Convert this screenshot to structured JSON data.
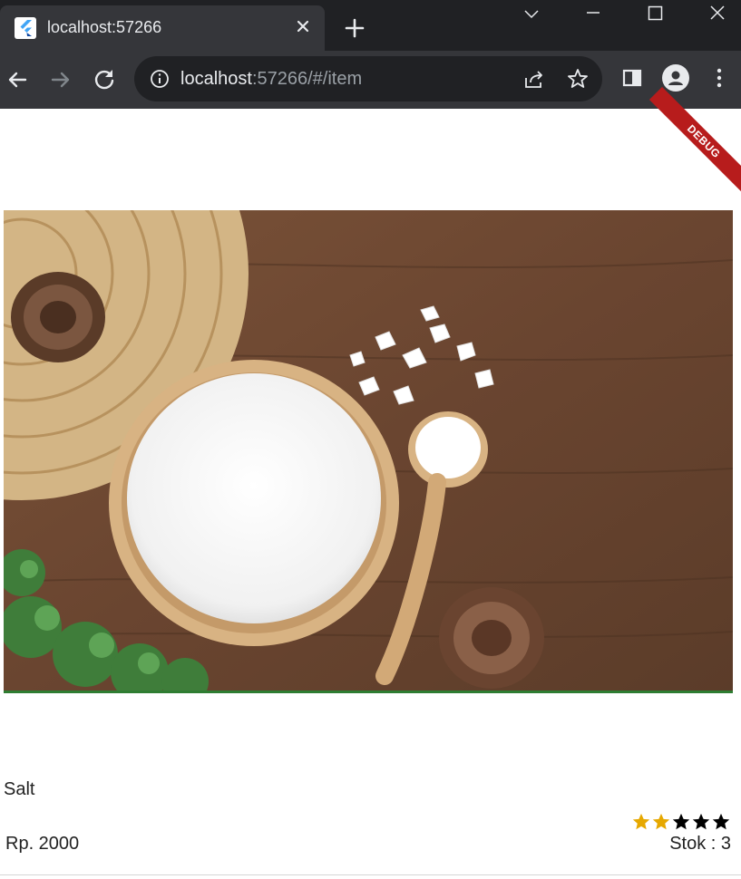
{
  "browser": {
    "tab": {
      "title": "localhost:57266",
      "close_icon": "close-icon",
      "favicon": "flutter-logo-icon"
    },
    "new_tab_icon": "plus-icon",
    "window_controls": [
      "chevron-down-icon",
      "minimize-icon",
      "maximize-icon",
      "close-icon"
    ],
    "nav": [
      "back-arrow-icon",
      "forward-arrow-icon",
      "reload-icon"
    ],
    "address": {
      "host": "localhost",
      "rest": ":57266/#/item"
    },
    "colors": {
      "frame": "#202124",
      "toolbar": "#35363a",
      "text": "#e8eaed",
      "muted": "#9aa0a6"
    }
  },
  "app": {
    "debug_banner": "DEBUG",
    "image": {
      "alt_icon": "salt-photo"
    },
    "item": {
      "name": "Salt",
      "price": "Rp. 2000",
      "stock": "Stok : 3",
      "rating": 2,
      "rating_max": 5,
      "colors": {
        "star_filled": "#e6a800",
        "star_empty": "#000000",
        "accent": "#2e7d32"
      }
    }
  }
}
